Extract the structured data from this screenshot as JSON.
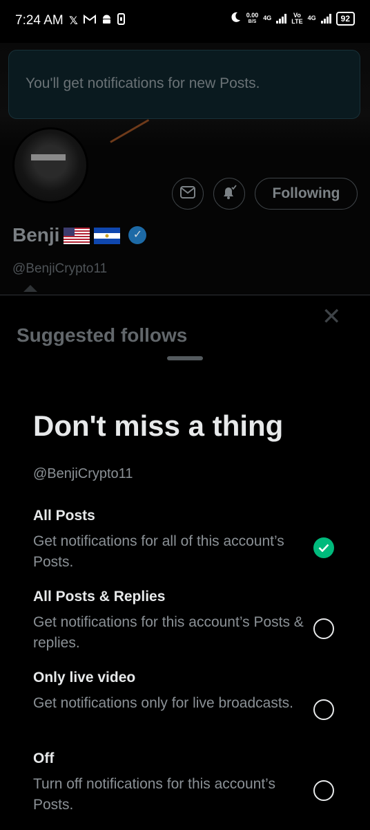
{
  "status_bar": {
    "time": "7:24 AM",
    "left_icons": [
      "x-icon",
      "gmail-icon",
      "android-icon",
      "phone-icon"
    ],
    "net_speed_value": "0.00",
    "net_speed_unit": "B/S",
    "net_1": "4G",
    "volte_top": "Vo",
    "volte_bottom": "LTE",
    "net_2": "4G",
    "battery": "92"
  },
  "toast": {
    "text": "You'll get notifications for new Posts."
  },
  "profile": {
    "name": "Benji",
    "flags": [
      "us-flag",
      "el-salvador-flag"
    ],
    "handle": "@BenjiCrypto11",
    "following_label": "Following",
    "verified_color": "#1d9bf0"
  },
  "suggested": {
    "title": "Suggested follows"
  },
  "sheet": {
    "title": "Don't miss a thing",
    "handle": "@BenjiCrypto11",
    "options": [
      {
        "title": "All Posts",
        "description": "Get notifications for all of this account’s Posts.",
        "selected": true
      },
      {
        "title": "All Posts & Replies",
        "description": "Get notifications for this account’s Posts & replies.",
        "selected": false
      },
      {
        "title": "Only live video",
        "description": "Get notifications only for live broadcasts.",
        "selected": false
      },
      {
        "title": "Off",
        "description": "Turn off notifications for this account’s Posts.",
        "selected": false
      }
    ],
    "accent": "#00ba7c"
  }
}
